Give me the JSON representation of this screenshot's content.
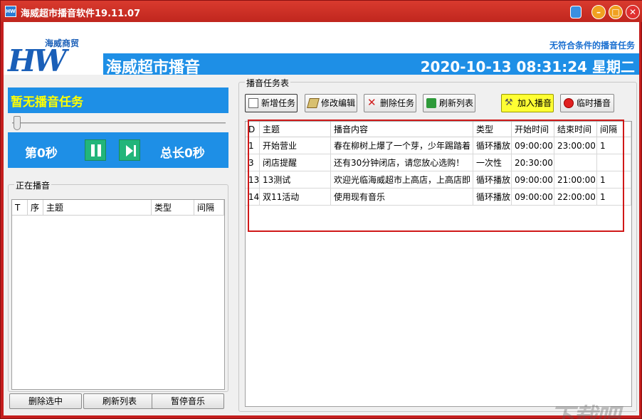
{
  "window": {
    "title": "海威超市播音软件19.11.07",
    "icon_text": "HW"
  },
  "header": {
    "logo_letters": "HW",
    "logo_company": "海威商贸",
    "brand_name": "海威超市播音",
    "status_right": "无符合条件的播音任务",
    "datetime": "2020-10-13 08:31:24 星期二"
  },
  "player": {
    "no_task": "暂无播音任务",
    "current": "第0秒",
    "total": "总长0秒",
    "progress": 0
  },
  "playing_group": {
    "label": "正在播音",
    "columns": [
      "T",
      "序",
      "主题",
      "类型",
      "间隔"
    ]
  },
  "bottom_buttons": {
    "delete_selected": "删除选中",
    "refresh_list": "刷新列表",
    "pause_music": "暂停音乐"
  },
  "task_group": {
    "label": "播音任务表",
    "toolbar": {
      "add": "新增任务",
      "edit": "修改编辑",
      "delete": "删除任务",
      "refresh": "刷新列表",
      "join": "加入播音",
      "temp": "临时播音"
    },
    "columns": [
      "D",
      "主题",
      "播音内容",
      "类型",
      "开始时间",
      "结束时间",
      "间隔"
    ],
    "rows": [
      {
        "id": "1",
        "subject": "开始营业",
        "content": "春在柳树上爆了一个芽，少年踢踏着",
        "type": "循环播放",
        "start": "09:00:00",
        "end": "23:00:00",
        "interval": "1"
      },
      {
        "id": "3",
        "subject": "闭店提醒",
        "content": "还有30分钟闭店，请您放心选购！",
        "type": "一次性",
        "start": "20:30:00",
        "end": "",
        "interval": ""
      },
      {
        "id": "13",
        "subject": "13测试",
        "content": "欢迎光临海威超市上高店，上高店即",
        "type": "循环播放",
        "start": "09:00:00",
        "end": "21:00:00",
        "interval": "1"
      },
      {
        "id": "14",
        "subject": "双11活动",
        "content": "使用现有音乐",
        "type": "循环播放",
        "start": "09:00:00",
        "end": "22:00:00",
        "interval": "1"
      }
    ]
  },
  "watermark": "下载吧"
}
